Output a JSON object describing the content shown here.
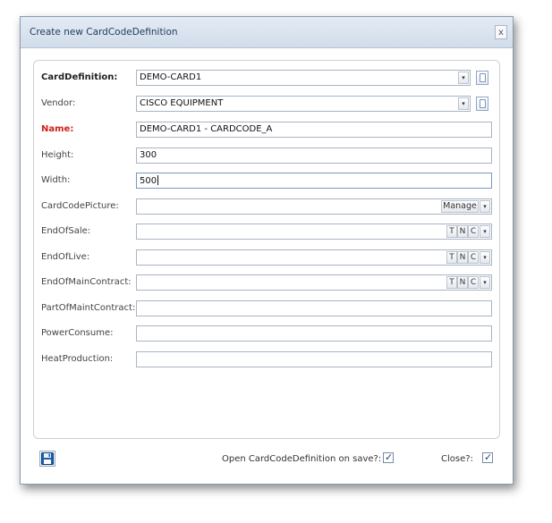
{
  "window": {
    "title": "Create new CardCodeDefinition",
    "close_label": "x"
  },
  "form": {
    "card_definition": {
      "label": "CardDefinition:",
      "value": "DEMO-CARD1"
    },
    "vendor": {
      "label": "Vendor:",
      "value": "CISCO EQUIPMENT"
    },
    "name": {
      "label": "Name:",
      "value": "DEMO-CARD1 - CARDCODE_A"
    },
    "height": {
      "label": "Height:",
      "value": "300"
    },
    "width": {
      "label": "Width:",
      "value": "500"
    },
    "card_code_picture": {
      "label": "CardCodePicture:",
      "value": "",
      "button": "Manage"
    },
    "end_of_sale": {
      "label": "EndOfSale:",
      "value": ""
    },
    "end_of_live": {
      "label": "EndOfLive:",
      "value": ""
    },
    "end_of_main_contract": {
      "label": "EndOfMainContract:",
      "value": ""
    },
    "part_of_maint_contract": {
      "label": "PartOfMaintContract:",
      "value": ""
    },
    "power_consume": {
      "label": "PowerConsume:",
      "value": ""
    },
    "heat_production": {
      "label": "HeatProduction:",
      "value": ""
    },
    "date_triggers": {
      "t": "T",
      "n": "N",
      "c": "C"
    },
    "dropdown_glyph": "▾"
  },
  "footer": {
    "open_on_save_label": "Open CardCodeDefinition on save?:",
    "open_on_save_checked": true,
    "close_label": "Close?:",
    "close_checked": true,
    "check_glyph": "✓"
  },
  "colors": {
    "required_label": "#d0201b",
    "title_text": "#1f3a5f",
    "save_icon": "#1c5fb0"
  }
}
